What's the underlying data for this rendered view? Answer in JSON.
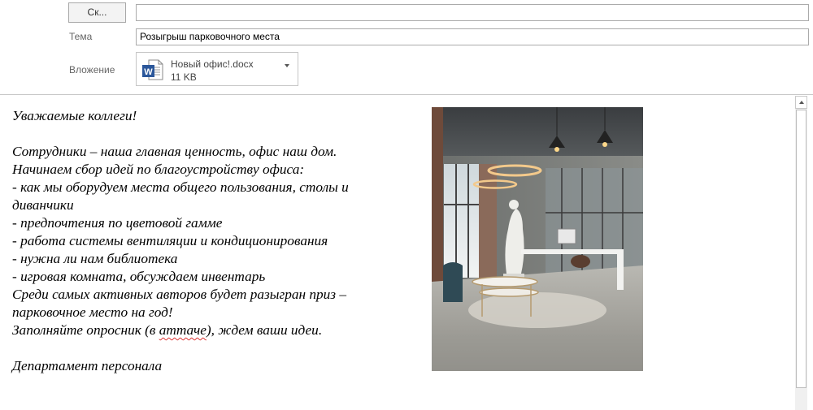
{
  "header": {
    "cc_button_label": "Ск...",
    "cc_value": "",
    "subject_label": "Тема",
    "subject_value": "Розыгрыш парковочного места",
    "attachment_label": "Вложение",
    "attachment": {
      "icon": "word-doc-icon",
      "icon_letter": "W",
      "name": "Новый офис!.docx",
      "size": "11 KB"
    }
  },
  "message": {
    "greeting": "Уважаемые коллеги!",
    "intro": "Сотрудники – наша главная ценность, офис наш дом.",
    "lead": "Начинаем сбор идей по благоустройству офиса:",
    "items": [
      "- как мы оборудуем места общего пользования, столы и диванчики",
      "- предпочтения по цветовой гамме",
      "- работа системы вентиляции и кондиционирования",
      "- нужна ли нам библиотека",
      "- игровая комната, обсуждаем инвентарь"
    ],
    "prize_line1": "Среди самых активных авторов будет разыгран приз –",
    "prize_line2": "парковочное место на год!",
    "cta_before": "Заполняйте опросник (в ",
    "cta_misspelled": "аттаче",
    "cta_after": "), ждем ваши идеи.",
    "signature": "Департамент персонала"
  },
  "colors": {
    "accent_word": "#2b579a",
    "spellcheck": "#d33333"
  }
}
